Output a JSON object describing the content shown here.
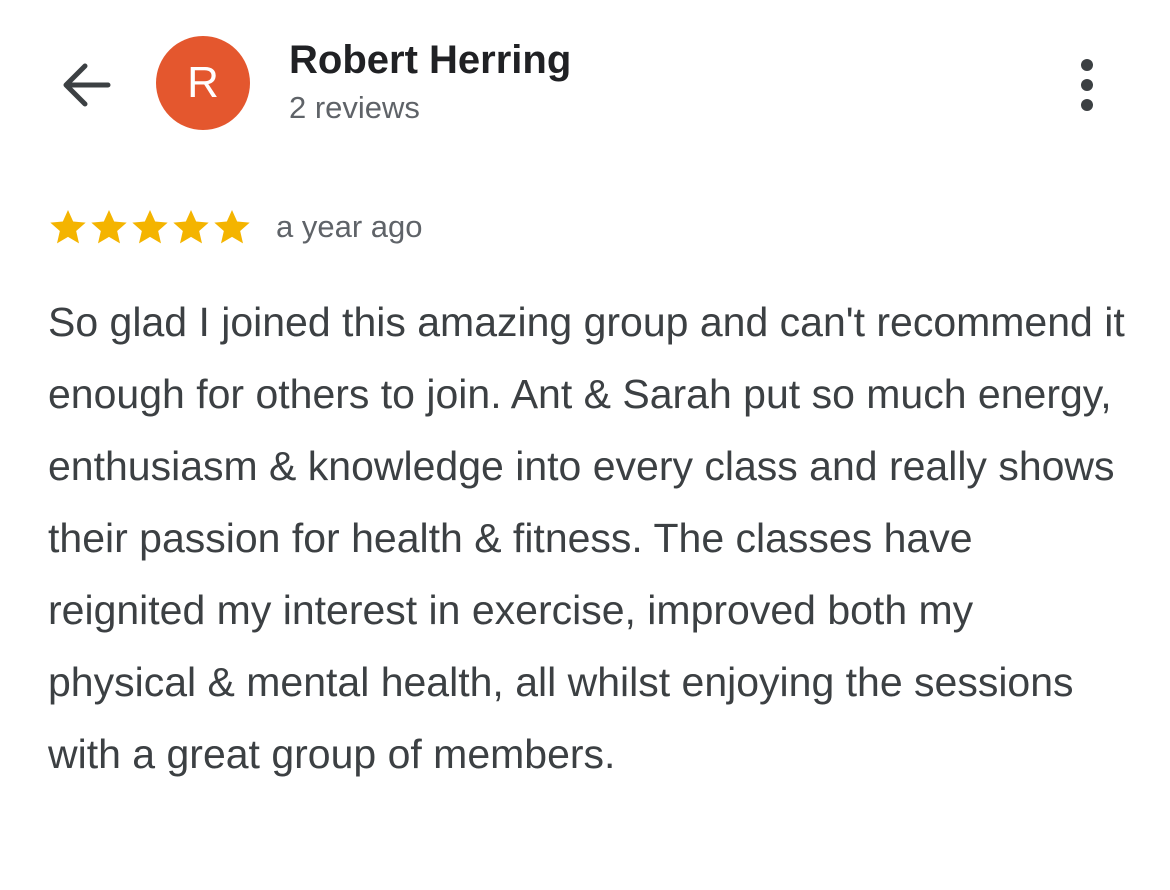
{
  "header": {
    "back_icon": "arrow-left-icon",
    "avatar_initial": "R",
    "avatar_color": "#e4572e",
    "reviewer_name": "Robert Herring",
    "review_count": "2 reviews",
    "more_icon": "more-vert-icon"
  },
  "review": {
    "rating": 5,
    "rating_max": 5,
    "star_color": "#f4b400",
    "timestamp": "a year ago",
    "text": "So glad I joined this amazing group and can't recommend it enough for others to join. Ant & Sarah put so much energy, enthusiasm & knowledge into every class and really shows their passion for health & fitness. The classes have reignited my interest in exercise, improved both my physical & mental health, all whilst enjoying the sessions with a great group of members."
  }
}
